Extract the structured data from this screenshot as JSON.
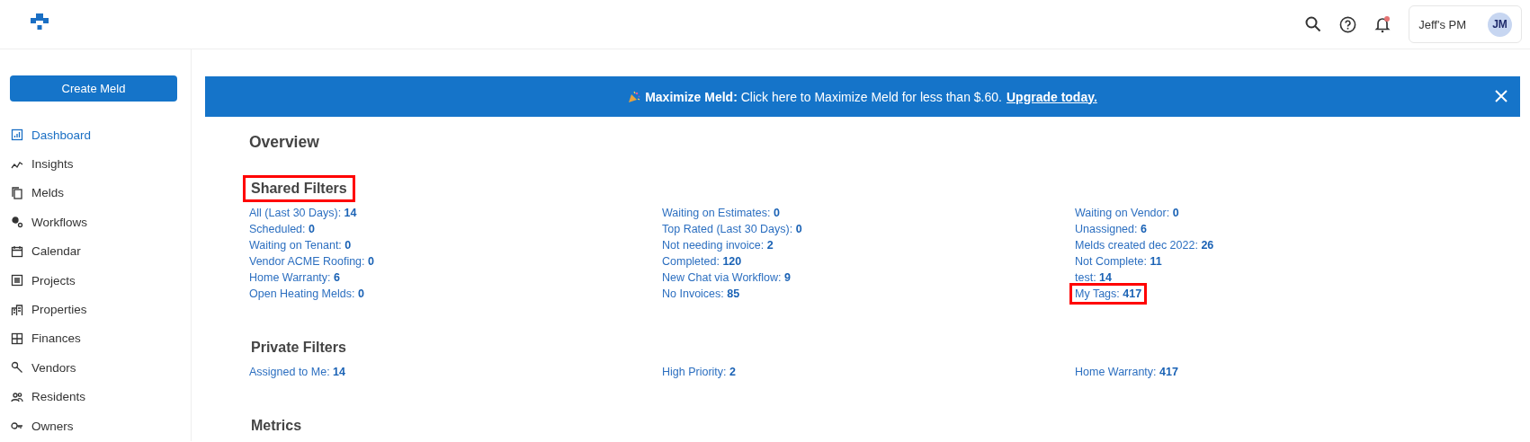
{
  "header": {
    "account": "Jeff's PM",
    "avatar_initials": "JM",
    "notifications_unread": true
  },
  "sidebar": {
    "create_button": "Create Meld",
    "items": [
      {
        "label": "Dashboard",
        "selected": true
      },
      {
        "label": "Insights",
        "selected": false
      },
      {
        "label": "Melds",
        "selected": false
      },
      {
        "label": "Workflows",
        "selected": false
      },
      {
        "label": "Calendar",
        "selected": false
      },
      {
        "label": "Projects",
        "selected": false
      },
      {
        "label": "Properties",
        "selected": false
      },
      {
        "label": "Finances",
        "selected": false
      },
      {
        "label": "Vendors",
        "selected": false
      },
      {
        "label": "Residents",
        "selected": false
      },
      {
        "label": "Owners",
        "selected": false
      }
    ]
  },
  "banner": {
    "text": "**Maximize Meld:** Click here to Maximize Meld for less than $.60.",
    "link": "Upgrade today."
  },
  "title": "Overview",
  "sections": [
    {
      "title": "Shared Filters",
      "highlighted": true,
      "columns": [
        [
          {
            "label": "All (Last 30 Days):",
            "count": "14",
            "highlighted": false
          },
          {
            "label": "Scheduled:",
            "count": "0",
            "highlighted": false
          },
          {
            "label": "Waiting on Tenant:",
            "count": "0",
            "highlighted": false
          },
          {
            "label": "Vendor ACME Roofing:",
            "count": "0",
            "highlighted": false
          },
          {
            "label": "Home Warranty:",
            "count": "6",
            "highlighted": false
          },
          {
            "label": "Open Heating Melds:",
            "count": "0",
            "highlighted": false
          }
        ],
        [
          {
            "label": "Waiting on Estimates:",
            "count": "0",
            "highlighted": false
          },
          {
            "label": "Top Rated (Last 30 Days):",
            "count": "0",
            "highlighted": false
          },
          {
            "label": "Not needing invoice:",
            "count": "2",
            "highlighted": false
          },
          {
            "label": "Completed:",
            "count": "120",
            "highlighted": false
          },
          {
            "label": "New Chat via Workflow:",
            "count": "9",
            "highlighted": false
          },
          {
            "label": "No Invoices:",
            "count": "85",
            "highlighted": false
          }
        ],
        [
          {
            "label": "Waiting on Vendor:",
            "count": "0",
            "highlighted": false
          },
          {
            "label": "Unassigned:",
            "count": "6",
            "highlighted": false
          },
          {
            "label": "Melds created dec 2022:",
            "count": "26",
            "highlighted": false
          },
          {
            "label": "Not Complete:",
            "count": "11",
            "highlighted": false
          },
          {
            "label": "test:",
            "count": "14",
            "highlighted": false
          },
          {
            "label": "My Tags:",
            "count": "417",
            "highlighted": true
          }
        ]
      ]
    },
    {
      "title": "Private Filters",
      "highlighted": false,
      "columns": [
        [
          {
            "label": "Assigned to Me:",
            "count": "14",
            "highlighted": false
          }
        ],
        [
          {
            "label": "High Priority:",
            "count": "2",
            "highlighted": false
          }
        ],
        [
          {
            "label": "Home Warranty:",
            "count": "417",
            "highlighted": false
          }
        ]
      ]
    },
    {
      "title": "Metrics",
      "highlighted": false
    }
  ]
}
